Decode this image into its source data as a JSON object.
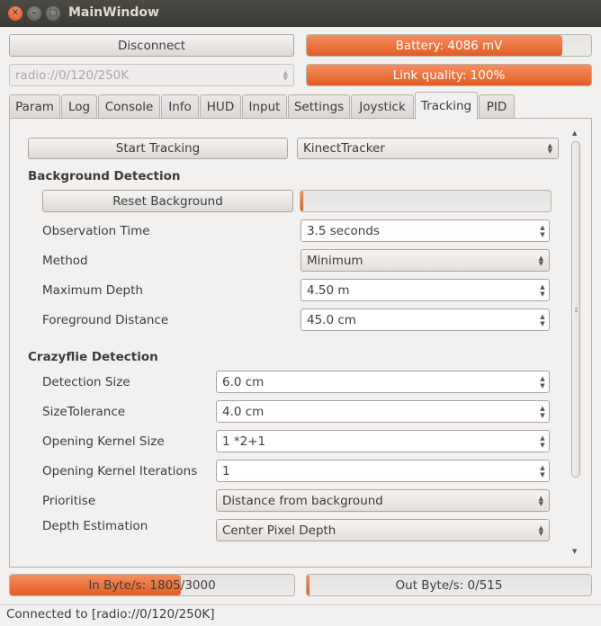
{
  "window": {
    "title": "MainWindow"
  },
  "top": {
    "disconnect_label": "Disconnect",
    "radio_uri": "radio://0/120/250K",
    "battery": {
      "text": "Battery: 4086 mV",
      "fraction": 0.9
    },
    "link_quality": {
      "text": "Link quality: 100%",
      "fraction": 1.0
    }
  },
  "tabs": [
    {
      "label": "Param"
    },
    {
      "label": "Log"
    },
    {
      "label": "Console"
    },
    {
      "label": "Info"
    },
    {
      "label": "HUD"
    },
    {
      "label": "Input"
    },
    {
      "label": "Settings"
    },
    {
      "label": "Joystick"
    },
    {
      "label": "Tracking",
      "active": true
    },
    {
      "label": "PID"
    }
  ],
  "tracking": {
    "start_label": "Start Tracking",
    "tracker_select": "KinectTracker",
    "background": {
      "heading": "Background Detection",
      "reset_label": "Reset Background",
      "progress_fraction": 0.01,
      "observation_time": {
        "label": "Observation Time",
        "value": "3.5 seconds"
      },
      "method": {
        "label": "Method",
        "value": "Minimum"
      },
      "max_depth": {
        "label": "Maximum Depth",
        "value": "4.50 m"
      },
      "fg_distance": {
        "label": "Foreground Distance",
        "value": "45.0 cm"
      }
    },
    "crazyflie": {
      "heading": "Crazyflie Detection",
      "detection_size": {
        "label": "Detection Size",
        "value": "6.0 cm"
      },
      "size_tolerance": {
        "label": "SizeTolerance",
        "value": "4.0 cm"
      },
      "kernel_size": {
        "label": "Opening Kernel Size",
        "value": "1 *2+1"
      },
      "kernel_iter": {
        "label": "Opening Kernel Iterations",
        "value": "1"
      },
      "prioritise": {
        "label": "Prioritise",
        "value": "Distance from background"
      },
      "depth_est": {
        "label": "Depth Estimation",
        "value": "Center Pixel Depth"
      }
    }
  },
  "bottom": {
    "in_bytes": {
      "text": "In Byte/s: 1805/3000",
      "fraction": 0.6017
    },
    "out_bytes": {
      "text": "Out Byte/s: 0/515",
      "fraction": 0.0
    }
  },
  "status_bar": {
    "text": "Connected to [radio://0/120/250K]"
  },
  "colors": {
    "accent": "#e9642a",
    "titlebar": "#3c3b37"
  }
}
